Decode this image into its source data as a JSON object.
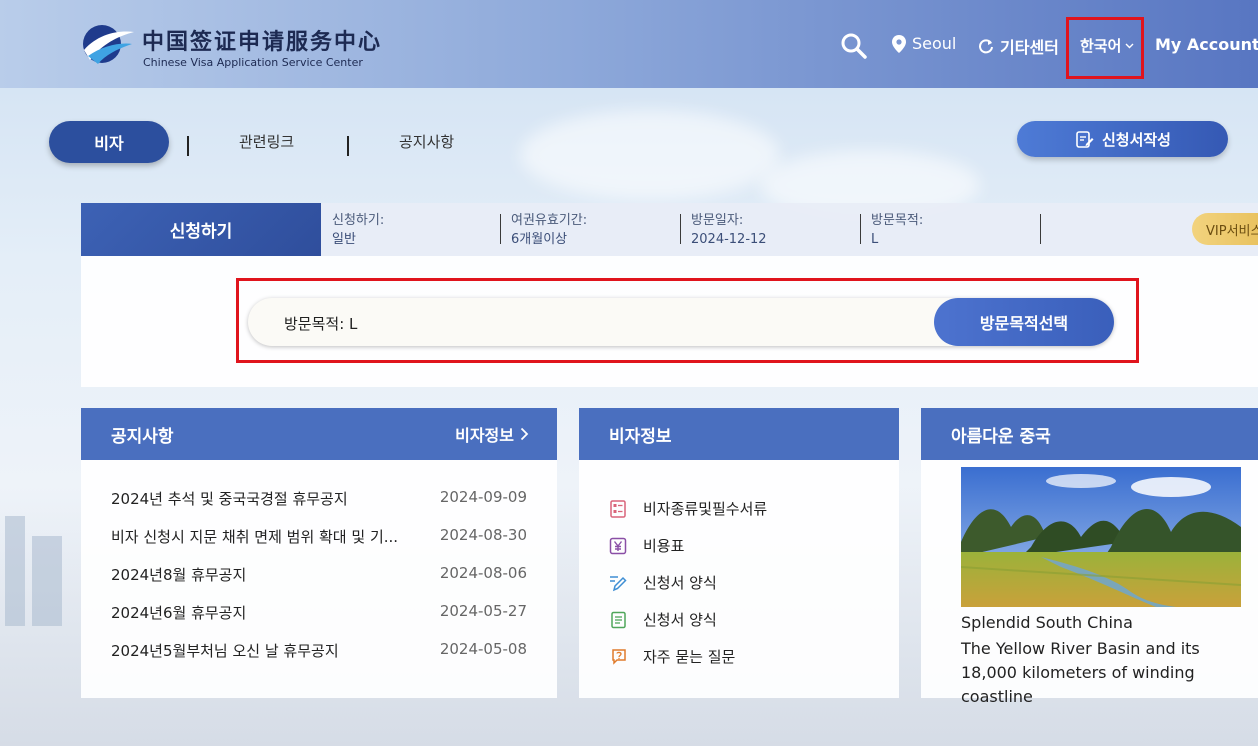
{
  "header": {
    "logo_cn": "中国签证申请服务中心",
    "logo_en": "Chinese Visa Application Service Center",
    "location": "Seoul",
    "other_center": "기타센터",
    "language": "한국어",
    "account": "My Account"
  },
  "tabs": {
    "visa": "비자",
    "links": "관련링크",
    "notice": "공지사항",
    "apply_form": "신청서작성"
  },
  "apply_bar": {
    "title": "신청하기",
    "fields": [
      {
        "label": "신청하기:",
        "value": "일반"
      },
      {
        "label": "여권유효기간:",
        "value": "6개월이상"
      },
      {
        "label": "방문일자:",
        "value": "2024-12-12"
      },
      {
        "label": "방문목적:",
        "value": "L"
      }
    ],
    "vip": "VIP서비스"
  },
  "purpose_search": {
    "value": "방문목적: L",
    "button": "방문목적선택"
  },
  "notice_card": {
    "title": "공지사항",
    "more": "비자정보",
    "items": [
      {
        "title": "2024년 추석 및 중국국경절 휴무공지",
        "date": "2024-09-09"
      },
      {
        "title": "비자 신청시 지문 채취 면제 범위 확대 및 기...",
        "date": "2024-08-30"
      },
      {
        "title": "2024년8월 휴무공지",
        "date": "2024-08-06"
      },
      {
        "title": "2024년6월 휴무공지",
        "date": "2024-05-27"
      },
      {
        "title": "2024년5월부처님 오신 날 휴무공지",
        "date": "2024-05-08"
      }
    ]
  },
  "info_card": {
    "title": "비자정보",
    "items": [
      {
        "label": "비자종류및필수서류",
        "icon": "document-list-icon"
      },
      {
        "label": "비용표",
        "icon": "yen-icon"
      },
      {
        "label": "신청서 양식",
        "icon": "pen-edit-icon"
      },
      {
        "label": "신청서 양식",
        "icon": "form-page-icon"
      },
      {
        "label": "자주 묻는 질문",
        "icon": "question-chat-icon"
      }
    ]
  },
  "china_card": {
    "title": "아름다운 중국",
    "image_caption": "Splendid South China",
    "description": "The Yellow River Basin and its 18,000 kilometers of winding coastline"
  }
}
